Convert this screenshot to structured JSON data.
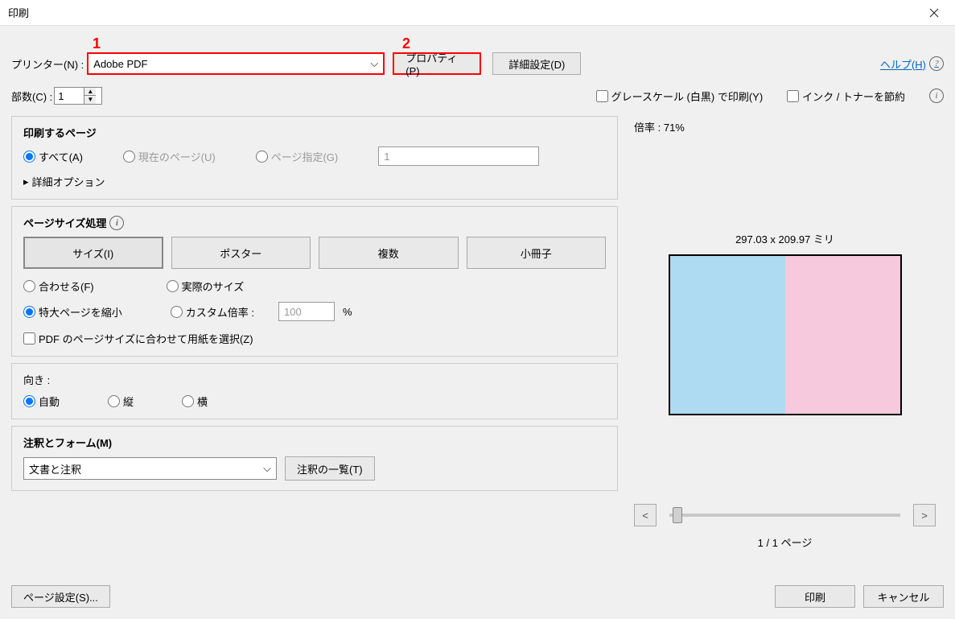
{
  "title": "印刷",
  "annotations": {
    "a1": "1",
    "a2": "2"
  },
  "row1": {
    "printer_label": "プリンター(N) :",
    "printer_value": "Adobe PDF",
    "properties_btn": "プロパティ(P)",
    "advanced_btn": "詳細設定(D)",
    "help": "ヘルプ(H)"
  },
  "row2": {
    "copies_label": "部数(C) :",
    "copies_value": "1",
    "grayscale": "グレースケール (白黒) で印刷(Y)",
    "save_ink": "インク / トナーを節約"
  },
  "pages": {
    "title": "印刷するページ",
    "all": "すべて(A)",
    "current": "現在のページ(U)",
    "range": "ページ指定(G)",
    "range_value": "1",
    "more_options": "詳細オプション"
  },
  "sizing": {
    "title": "ページサイズ処理",
    "size_btn": "サイズ(I)",
    "poster_btn": "ポスター",
    "multiple_btn": "複数",
    "booklet_btn": "小冊子",
    "fit": "合わせる(F)",
    "actual": "実際のサイズ",
    "shrink": "特大ページを縮小",
    "custom": "カスタム倍率 :",
    "custom_value": "100",
    "percent": "%",
    "choose_paper": "PDF のページサイズに合わせて用紙を選択(Z)"
  },
  "orientation": {
    "title": "向き :",
    "auto": "自動",
    "portrait": "縦",
    "landscape": "横"
  },
  "comments": {
    "title": "注釈とフォーム(M)",
    "value": "文書と注釈",
    "summarize_btn": "注釈の一覧(T)"
  },
  "preview": {
    "scale_label": "倍率 : 71%",
    "dimensions": "297.03 x 209.97 ミリ",
    "page_indicator": "1 / 1 ページ",
    "prev": "<",
    "next": ">"
  },
  "bottom": {
    "page_setup": "ページ設定(S)...",
    "print": "印刷",
    "cancel": "キャンセル"
  }
}
